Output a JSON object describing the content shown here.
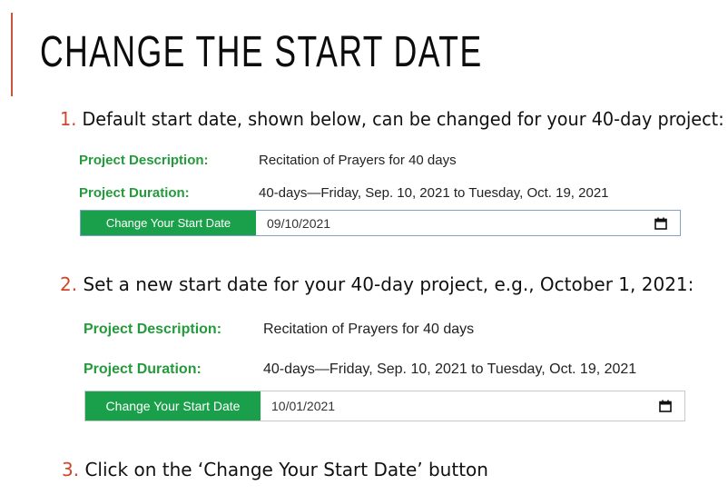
{
  "slide": {
    "title": "CHANGE THE START DATE"
  },
  "steps": [
    {
      "number": "1.",
      "text": "Default start date, shown below, can be changed for your 40-day project:"
    },
    {
      "number": "2.",
      "text": "Set a new start date for your 40-day project, e.g., October 1, 2021:"
    },
    {
      "number": "3.",
      "text": "Click on the ‘Change Your Start Date’ button"
    }
  ],
  "panels": [
    {
      "description_label": "Project Description:",
      "description_value": "Recitation of Prayers for 40 days",
      "duration_label": "Project Duration:",
      "duration_value": "40-days—Friday, Sep. 10, 2021 to Tuesday, Oct. 19, 2021",
      "button_label": "Change Your Start Date",
      "date_value": "09/10/2021",
      "icon": "calendar-icon"
    },
    {
      "description_label": "Project Description:",
      "description_value": "Recitation of Prayers for 40 days",
      "duration_label": "Project Duration:",
      "duration_value": "40-days—Friday, Sep. 10, 2021 to Tuesday, Oct. 19, 2021",
      "button_label": "Change Your Start Date",
      "date_value": "10/01/2021",
      "icon": "calendar-icon"
    }
  ],
  "colors": {
    "accent": "#c8553d",
    "step_number": "#d1462b",
    "label_green": "#239a3b",
    "button_green": "#1aa04a",
    "input_focus_border": "#7fa4c7"
  }
}
